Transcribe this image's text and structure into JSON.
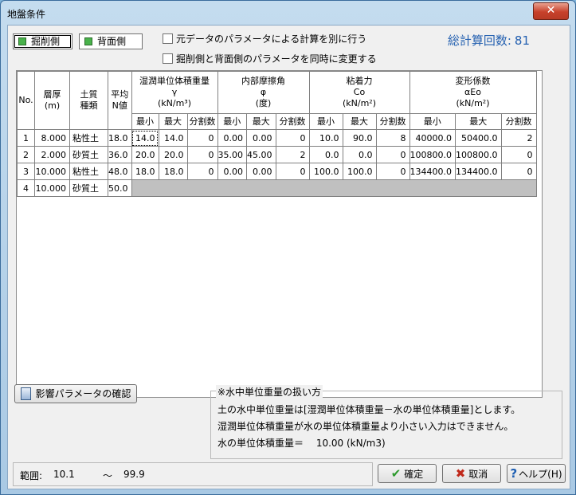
{
  "window": {
    "title": "地盤条件",
    "close_glyph": "✕"
  },
  "toggles": {
    "excavation": "掘削側",
    "back": "背面側"
  },
  "options": [
    {
      "label": "元データのパラメータによる計算を別に行う",
      "checked": false
    },
    {
      "label": "掘削側と背面側のパラメータを同時に変更する",
      "checked": false
    }
  ],
  "calc_count": {
    "label": "総計算回数:",
    "value": "81"
  },
  "grid": {
    "headers": {
      "no": "No.",
      "thickness": [
        "層厚",
        "(m)"
      ],
      "soil": [
        "土質",
        "種類"
      ],
      "n": [
        "平均",
        "N値"
      ],
      "gamma": [
        "湿潤単位体積重量",
        "γ",
        "(kN/m³)"
      ],
      "phi": [
        "内部摩擦角",
        "φ",
        "(度)"
      ],
      "c": [
        "粘着力",
        "Co",
        "(kN/m²)"
      ],
      "e": [
        "変形係数",
        "αEo",
        "(kN/m²)"
      ],
      "sub": [
        "最小",
        "最大",
        "分割数"
      ]
    },
    "rows": [
      {
        "no": "1",
        "thickness": "8.000",
        "soil": "粘性土",
        "n": "18.0",
        "g_min": "14.0",
        "g_max": "14.0",
        "g_div": "0",
        "p_min": "0.00",
        "p_max": "0.00",
        "p_div": "0",
        "c_min": "10.0",
        "c_max": "90.0",
        "c_div": "8",
        "e_min": "40000.0",
        "e_max": "50400.0",
        "e_div": "2"
      },
      {
        "no": "2",
        "thickness": "2.000",
        "soil": "砂質土",
        "n": "36.0",
        "g_min": "20.0",
        "g_max": "20.0",
        "g_div": "0",
        "p_min": "35.00",
        "p_max": "45.00",
        "p_div": "2",
        "c_min": "0.0",
        "c_max": "0.0",
        "c_div": "0",
        "e_min": "100800.0",
        "e_max": "100800.0",
        "e_div": "0"
      },
      {
        "no": "3",
        "thickness": "10.000",
        "soil": "粘性土",
        "n": "48.0",
        "g_min": "18.0",
        "g_max": "18.0",
        "g_div": "0",
        "p_min": "0.00",
        "p_max": "0.00",
        "p_div": "0",
        "c_min": "100.0",
        "c_max": "100.0",
        "c_div": "0",
        "e_min": "134400.0",
        "e_max": "134400.0",
        "e_div": "0"
      },
      {
        "no": "4",
        "thickness": "10.000",
        "soil": "砂質土",
        "n": "50.0"
      }
    ]
  },
  "influence_button": "影響パラメータの確認",
  "note": {
    "title": "※水中単位重量の扱い方",
    "lines": [
      "土の水中単位重量は[湿潤単位体積重量－水の単位体積重量]とします。",
      "湿潤単位体積重量が水の単位体積重量より小さい入力はできません。",
      "水の単位体積重量＝　 10.00 (kN/m3)"
    ]
  },
  "status": {
    "label": "範囲:",
    "min": "10.1",
    "sep": "～",
    "max": "99.9"
  },
  "buttons": {
    "ok": "確定",
    "cancel": "取消",
    "help": "ヘルプ(H)"
  },
  "colors": {
    "accent_text": "#2561b1",
    "toggle_indicator": "#49b24b",
    "ok_icon": "#2e9a2e",
    "cancel_icon": "#c0291b",
    "help_icon": "#1e5fb3"
  }
}
